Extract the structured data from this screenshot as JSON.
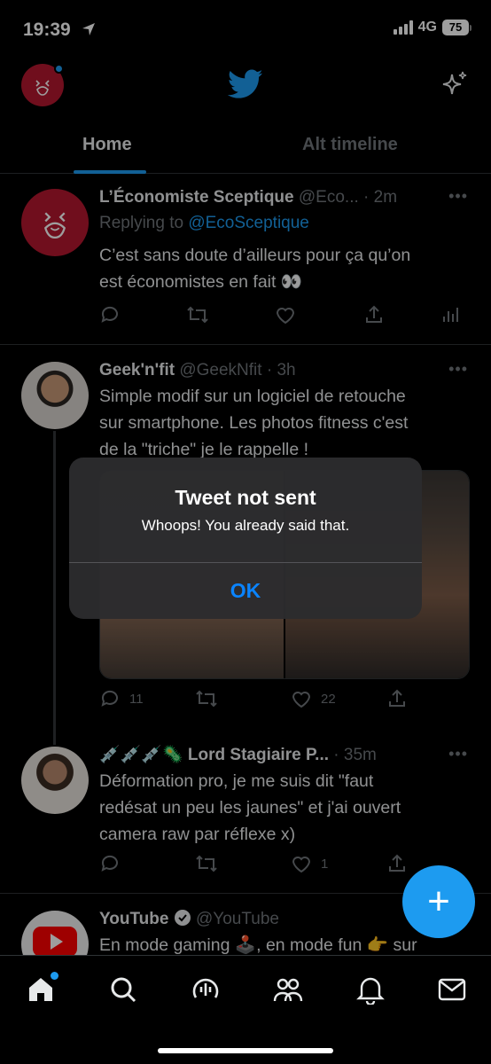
{
  "status": {
    "time": "19:39",
    "network": "4G",
    "battery": "75"
  },
  "header": {
    "tabs": [
      "Home",
      "Alt timeline"
    ]
  },
  "tweets": [
    {
      "name": "L’Économiste Sceptique",
      "handle": "@Eco...",
      "time": "2m",
      "reply_prefix": "Replying to",
      "reply_to": "@EcoSceptique",
      "lines": [
        "C’est sans doute d’ailleurs pour ça qu’on",
        "est économistes en fait 👀"
      ]
    },
    {
      "name": "Geek'n'fit",
      "handle": "@GeekNfit",
      "time": "3h",
      "lines": [
        "Simple modif sur un logiciel de retouche",
        "sur smartphone. Les photos fitness c'est",
        "de la \"triche\" je le rappelle !"
      ],
      "replies": "11",
      "likes": "22"
    },
    {
      "name_prefix": "💉💉💉🦠",
      "name": "Lord Stagiaire P...",
      "time": "35m",
      "lines": [
        "Déformation pro, je me suis dit \"faut",
        "redésat un peu les jaunes\" et j'ai ouvert",
        "camera raw par réflexe x)"
      ],
      "likes": "1"
    },
    {
      "name": "YouTube",
      "handle": "@YouTube",
      "lines": [
        "En mode gaming 🕹️, en mode fun 👉 sur"
      ]
    }
  ],
  "alert": {
    "title": "Tweet not sent",
    "message": "Whoops! You already said that.",
    "ok": "OK"
  },
  "fab": {
    "label": "+"
  },
  "colors": {
    "accent": "#1d9bf0",
    "ios_blue": "#0a84ff",
    "brand_red": "#b5172f"
  },
  "nav": [
    "home-icon",
    "search-icon",
    "spaces-icon",
    "communities-icon",
    "notifications-icon",
    "messages-icon"
  ]
}
